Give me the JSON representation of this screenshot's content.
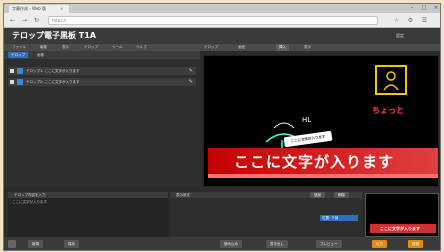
{
  "browser": {
    "tab_title": "字幕作成 - Web 版",
    "tab_close": "×",
    "window_controls": [
      "–",
      "□",
      "×"
    ],
    "nav": {
      "back": "←",
      "forward": "→",
      "reload": "↻"
    },
    "url": "https://",
    "toolbar_icons": [
      "☆",
      "⚙",
      "☰"
    ]
  },
  "app": {
    "title": "テロップ電子黒板 T1A",
    "header_button": "設定"
  },
  "menu": {
    "items": [
      "ファイル",
      "編集",
      "表示",
      "テロップ",
      "ツール",
      "ヘルプ"
    ],
    "right_items": [
      "テロップ",
      "画面",
      "挿入",
      "表示"
    ]
  },
  "left_panel": {
    "tabs": [
      "テロップ",
      "画像"
    ],
    "rows": [
      {
        "text": "テロップ1: ここに文字が入ります",
        "edit": "✎"
      },
      {
        "text": "テロップ2: ここに文字が入ります",
        "edit": "✎"
      }
    ]
  },
  "preview": {
    "handwriting_hl": "HL",
    "yellow_note": "ちょっと",
    "lower_small": "ここに文字が入ります",
    "caption": "ここに文字が入ります",
    "doodle_label": "ちょっと"
  },
  "bottom_left": {
    "header": "テロップ内容を入力",
    "text": "ここに文字が入ります"
  },
  "bottom_mid": {
    "header": "表示設定",
    "buttons": [
      "追加",
      "削除"
    ],
    "selected_option": "位置: 下部"
  },
  "thumbnail": {
    "caption": "ここに文字が入ります"
  },
  "footer": {
    "buttons": [
      "新規",
      "保存",
      "読み込み",
      "書き出し",
      "プレビュー"
    ],
    "orange_buttons": [
      "出力",
      "送信"
    ]
  }
}
